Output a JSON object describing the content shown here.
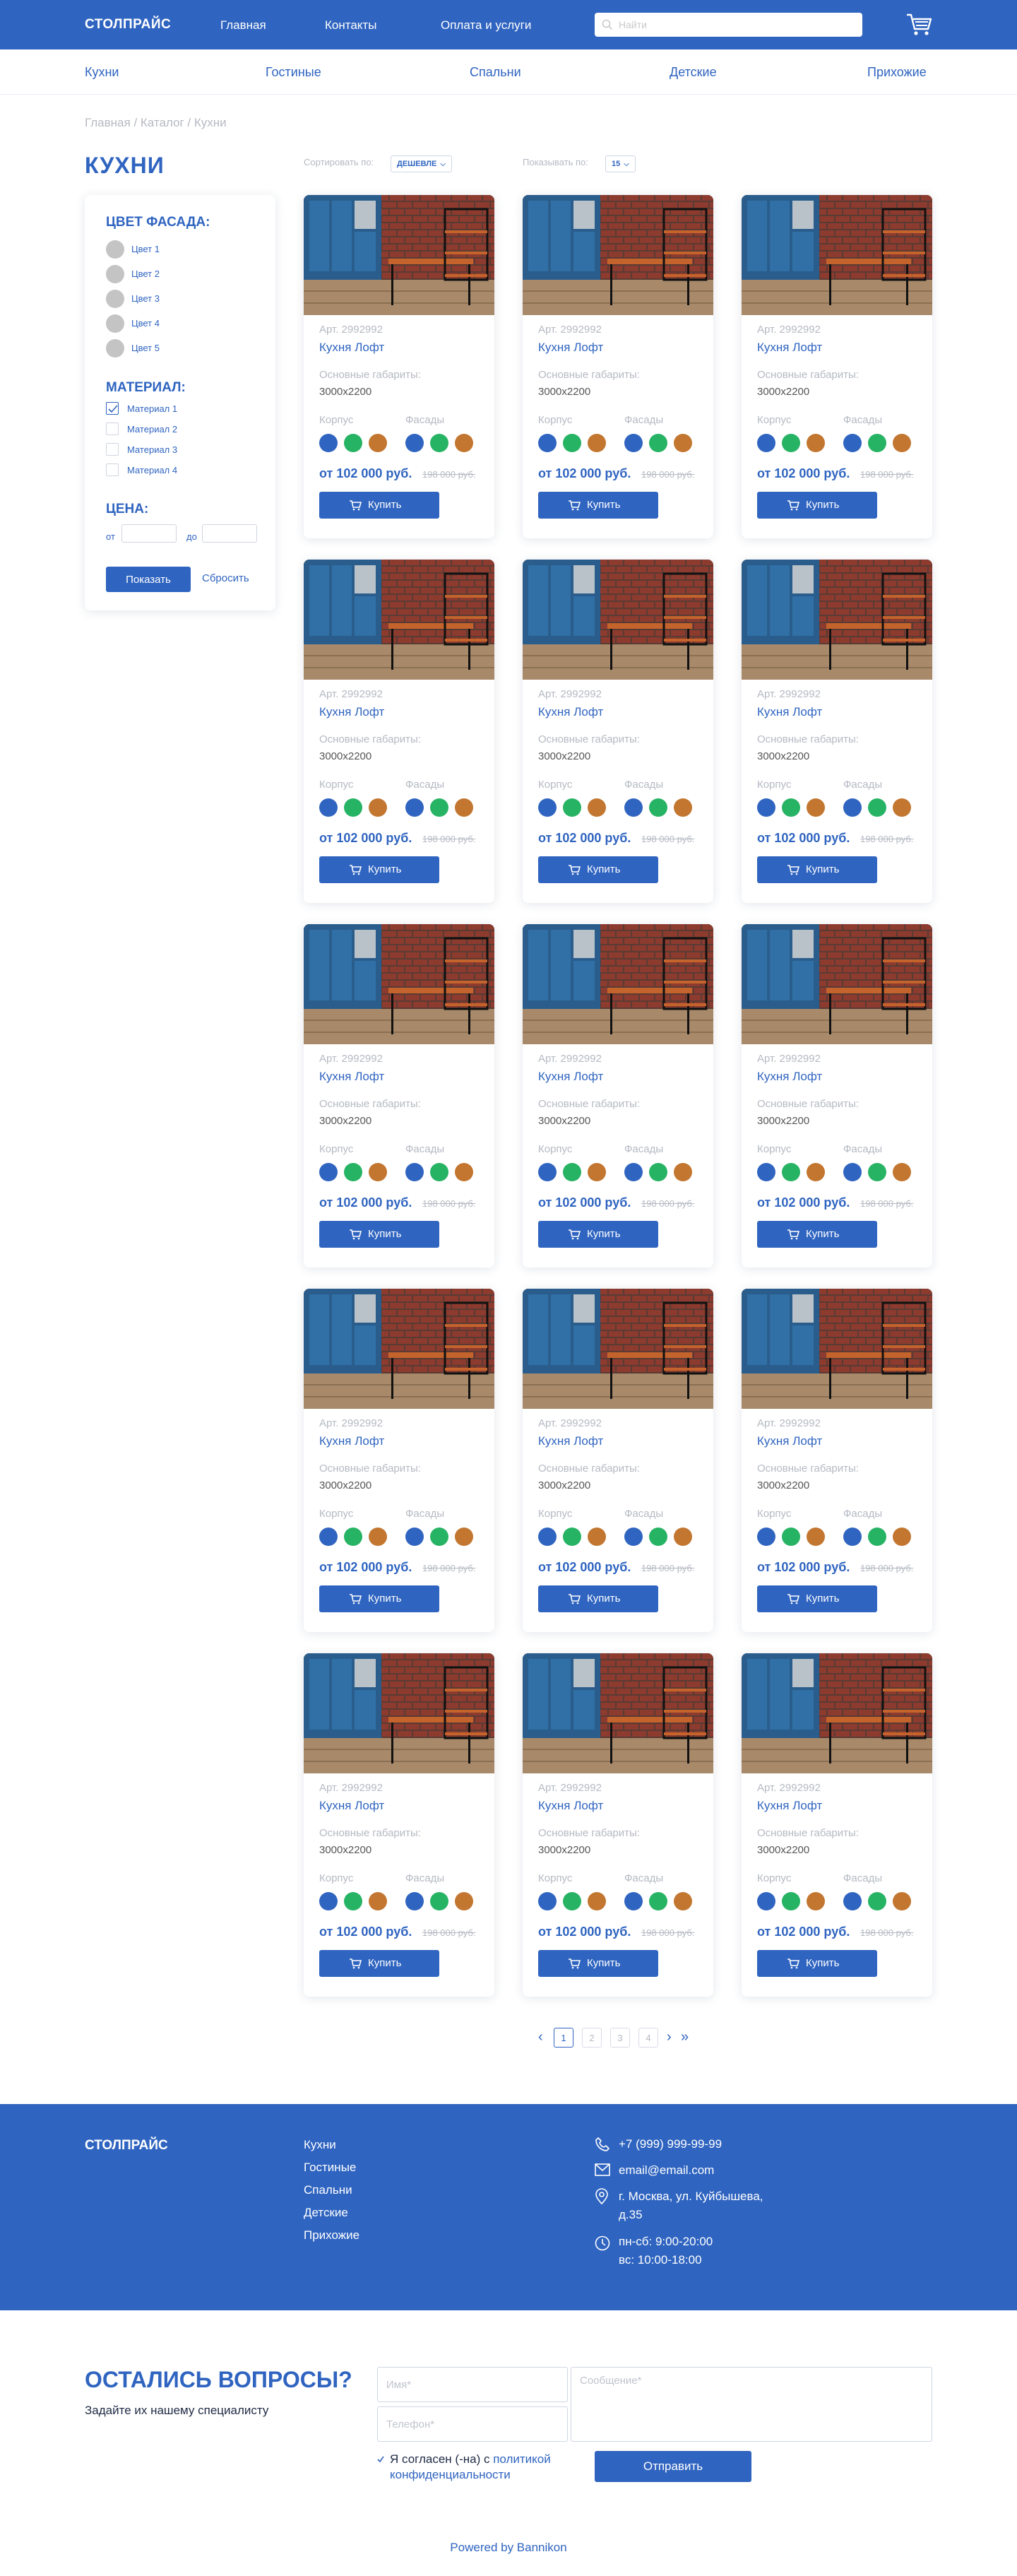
{
  "header": {
    "logo": "СТОЛПРАЙС",
    "nav": [
      "Главная",
      "Контакты",
      "Оплата и услуги"
    ],
    "search_placeholder": "Найти"
  },
  "categories": [
    "Кухни",
    "Гостиные",
    "Спальни",
    "Детские",
    "Прихожие"
  ],
  "breadcrumb": [
    "Главная",
    "Каталог",
    "Кухни"
  ],
  "breadcrumb_sep": " / ",
  "page_title": "КУХНИ",
  "toolbar": {
    "sort_label": "Сортировать по:",
    "sort_value": "ДЕШЕВЛЕ",
    "show_label": "Показывать по:",
    "show_value": "15"
  },
  "filter": {
    "color_title": "ЦВЕТ ФАСАДА:",
    "colors": [
      "Цвет 1",
      "Цвет 2",
      "Цвет 3",
      "Цвет 4",
      "Цвет 5"
    ],
    "material_title": "МАТЕРИАЛ:",
    "materials": [
      {
        "label": "Материал 1",
        "checked": true
      },
      {
        "label": "Материал 2",
        "checked": false
      },
      {
        "label": "Материал 3",
        "checked": false
      },
      {
        "label": "Материал 4",
        "checked": false
      }
    ],
    "price_title": "ЦЕНА:",
    "from_label": "от",
    "to_label": "до",
    "apply_label": "Показать",
    "reset_label": "Сбросить"
  },
  "product_template": {
    "sku": "Арт. 2992992",
    "name": "Кухня Лофт",
    "dims_label": "Основные габариты:",
    "dims_value": "3000x2200",
    "body_label": "Корпус",
    "facade_label": "Фасады",
    "swatch_colors": [
      "#2f64c0",
      "#27b364",
      "#c27630"
    ],
    "price": "от 102 000 руб.",
    "old_price": "198 000 руб.",
    "buy_label": "Купить"
  },
  "products_count": 15,
  "pagination": {
    "pages": [
      "1",
      "2",
      "3",
      "4"
    ],
    "current": "1"
  },
  "footer": {
    "logo": "СТОЛПРАЙС",
    "links": [
      "Кухни",
      "Гостиные",
      "Спальни",
      "Детские",
      "Прихожие"
    ],
    "phone": "+7 (999) 999-99-99",
    "email": "email@email.com",
    "address_line1": "г. Москва, ул. Куйбышева,",
    "address_line2": "д.35",
    "hours_line1": "пн-сб: 9:00-20:00",
    "hours_line2": "вс: 10:00-18:00"
  },
  "questions": {
    "title": "ОСТАЛИСЬ ВОПРОСЫ?",
    "subtitle": "Задайте их нашему специалисту",
    "name_placeholder": "Имя*",
    "phone_placeholder": "Телефон*",
    "message_placeholder": "Сообщение*",
    "agree_text": "Я согласен (-на) с ",
    "agree_link": "политикой конфиденциальности",
    "submit_label": "Отправить"
  },
  "powered": "Powered by Bannikon",
  "colors": {
    "brand": "#2f64c0",
    "green": "#27b364",
    "orange": "#c27630",
    "swatch_grey": "#c4c4c4"
  }
}
